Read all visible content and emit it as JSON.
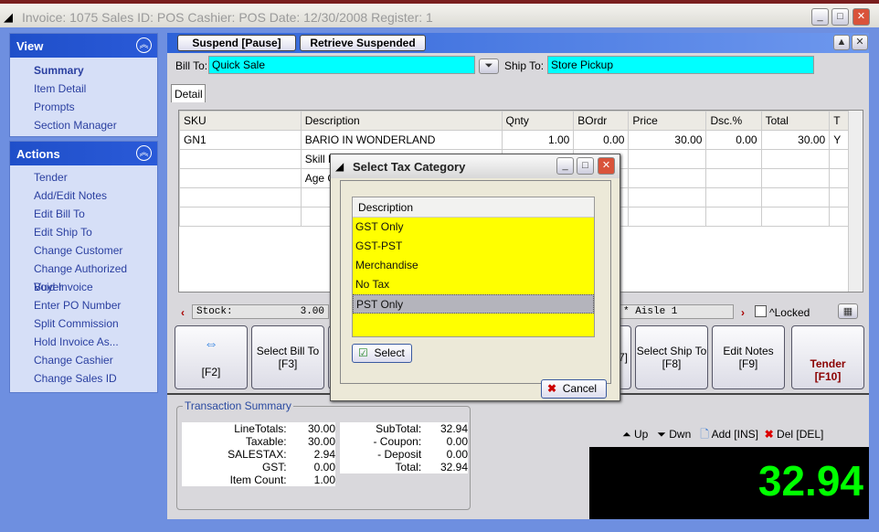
{
  "window": {
    "title": "Invoice: 1075  Sales ID: POS  Cashier: POS  Date: 12/30/2008  Register: 1"
  },
  "sidebar": {
    "view": {
      "title": "View",
      "items": [
        "Summary",
        "Item Detail",
        "Prompts",
        "Section Manager"
      ]
    },
    "actions": {
      "title": "Actions",
      "items": [
        "Tender",
        "Add/Edit Notes",
        "Edit Bill To",
        "Edit Ship To",
        "Change Customer",
        "Change Authorized Buyer",
        "Void Invoice",
        "Enter PO Number",
        "Split Commission",
        "Hold Invoice As...",
        "Change Cashier",
        "Change Sales ID"
      ]
    }
  },
  "toolbar": {
    "suspend": "Suspend [Pause]",
    "retrieve": "Retrieve Suspended"
  },
  "bill_to": {
    "label": "Bill To:",
    "value": "Quick Sale"
  },
  "ship_to": {
    "label": "Ship To:",
    "value": "Store Pickup"
  },
  "tab": "Detail",
  "grid": {
    "columns": [
      "SKU",
      "Description",
      "Qnty",
      "BOrdr",
      "Price",
      "Dsc.%",
      "Total",
      "T"
    ],
    "rows": [
      [
        "GN1",
        "BARIO IN WONDERLAND",
        "1.00",
        "0.00",
        "30.00",
        "0.00",
        "30.00",
        "Y"
      ],
      [
        "",
        "Skill L",
        "",
        "",
        "",
        "",
        "",
        ""
      ],
      [
        "",
        "Age G",
        "",
        "",
        "",
        "",
        "",
        ""
      ]
    ]
  },
  "stock": {
    "label": "Stock:",
    "value": "3.00",
    "location": "* Aisle 1",
    "locked": "^Locked"
  },
  "fkeys": {
    "f2": "[F2]",
    "f3a": "Select Bill To",
    "f3b": "[F3]",
    "f7": "7]",
    "f8a": "Select Ship To",
    "f8b": "[F8]",
    "f9": "Edit Notes [F9]",
    "f10a": "Tender",
    "f10b": "[F10]"
  },
  "summary": {
    "title": "Transaction Summary",
    "left": [
      [
        "LineTotals:",
        "30.00"
      ],
      [
        "Taxable:",
        "30.00"
      ],
      [
        "SALESTAX:",
        "2.94"
      ],
      [
        "GST:",
        "0.00"
      ],
      [
        "Item Count:",
        "1.00"
      ]
    ],
    "right": [
      [
        "SubTotal:",
        "32.94"
      ],
      [
        "- Coupon:",
        "0.00"
      ],
      [
        "- Deposit",
        "0.00"
      ],
      [
        "Total:",
        "32.94"
      ]
    ]
  },
  "nav": {
    "up": "Up",
    "down": "Dwn",
    "add": "Add [INS]",
    "del": "Del [DEL]"
  },
  "total_display": "32.94",
  "dialog": {
    "title": "Select Tax Category",
    "column": "Description",
    "options": [
      "GST Only",
      "GST-PST",
      "Merchandise",
      "No Tax",
      "PST Only"
    ],
    "selected": "PST Only",
    "select": "Select",
    "cancel": "Cancel"
  },
  "colors": {
    "highlight": "#ffff00",
    "cyan": "#00ffff",
    "total": "#00ff00",
    "tender": "#8b0000"
  }
}
